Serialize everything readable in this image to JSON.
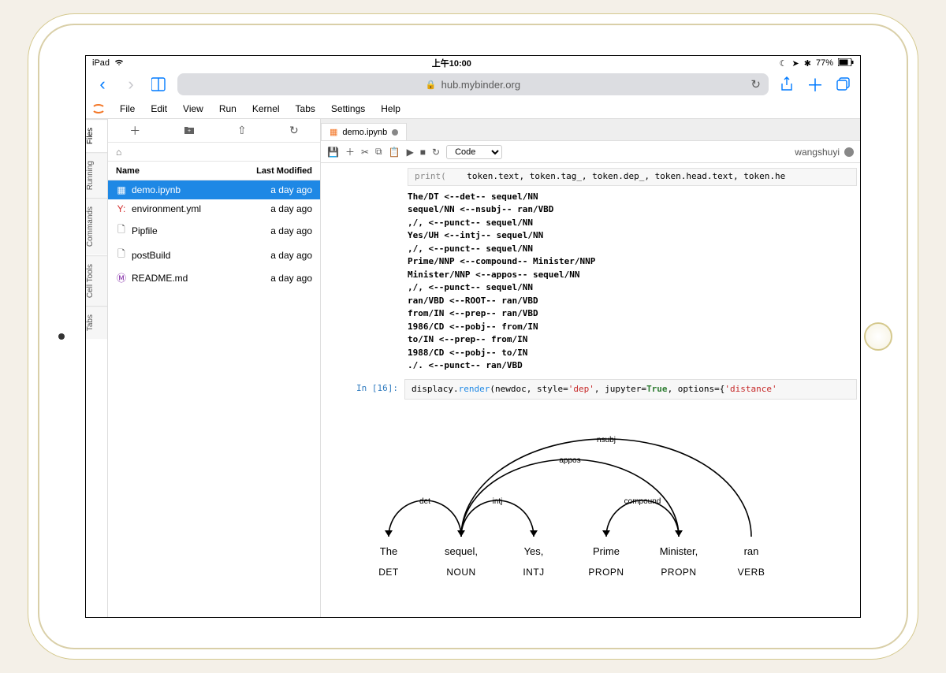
{
  "status": {
    "device": "iPad",
    "time": "上午10:00",
    "battery": "77%"
  },
  "safari": {
    "url": "hub.mybinder.org"
  },
  "menu": [
    "File",
    "Edit",
    "View",
    "Run",
    "Kernel",
    "Tabs",
    "Settings",
    "Help"
  ],
  "side_tabs": [
    "Files",
    "Running",
    "Commands",
    "Cell Tools",
    "Tabs"
  ],
  "browser": {
    "headers": {
      "name": "Name",
      "modified": "Last Modified"
    },
    "files": [
      {
        "icon": "nb",
        "name": "demo.ipynb",
        "modified": "a day ago",
        "selected": true,
        "color": "#fff"
      },
      {
        "icon": "yml",
        "name": "environment.yml",
        "modified": "a day ago"
      },
      {
        "icon": "file",
        "name": "Pipfile",
        "modified": "a day ago"
      },
      {
        "icon": "file",
        "name": "postBuild",
        "modified": "a day ago"
      },
      {
        "icon": "md",
        "name": "README.md",
        "modified": "a day ago"
      }
    ]
  },
  "tab": {
    "title": "demo.ipynb"
  },
  "nb_toolbar": {
    "cell_type": "Code",
    "user": "wangshuyi"
  },
  "code_peek": "    token.text, token.tag_, token.dep_, token.head.text, token.he",
  "output_lines": [
    "The/DT <--det-- sequel/NN",
    "sequel/NN <--nsubj-- ran/VBD",
    ",/, <--punct-- sequel/NN",
    "Yes/UH <--intj-- sequel/NN",
    ",/, <--punct-- sequel/NN",
    "Prime/NNP <--compound-- Minister/NNP",
    "Minister/NNP <--appos-- sequel/NN",
    ",/, <--punct-- sequel/NN",
    "ran/VBD <--ROOT-- ran/VBD",
    "from/IN <--prep-- ran/VBD",
    "1986/CD <--pobj-- from/IN",
    "to/IN <--prep-- from/IN",
    "1988/CD <--pobj-- to/IN",
    "./. <--punct-- ran/VBD"
  ],
  "cell": {
    "prompt": "In [16]:",
    "code_prefix": "displacy.",
    "call": "render",
    "arg1": "(newdoc, style=",
    "str1": "'dep'",
    "mid": ", jupyter=",
    "kw": "True",
    "tail": ", options={",
    "str2": "'distance'"
  },
  "dep": {
    "tokens": [
      {
        "text": "The",
        "pos": "DET"
      },
      {
        "text": "sequel,",
        "pos": "NOUN"
      },
      {
        "text": "Yes,",
        "pos": "INTJ"
      },
      {
        "text": "Prime",
        "pos": "PROPN"
      },
      {
        "text": "Minister,",
        "pos": "PROPN"
      },
      {
        "text": "ran",
        "pos": "VERB"
      }
    ],
    "arcs": [
      {
        "label": "det",
        "from": 0,
        "to": 1
      },
      {
        "label": "intj",
        "from": 2,
        "to": 1
      },
      {
        "label": "compound",
        "from": 3,
        "to": 4
      },
      {
        "label": "appos",
        "from": 4,
        "to": 1
      },
      {
        "label": "nsubj",
        "from": 1,
        "to": 5
      }
    ]
  }
}
